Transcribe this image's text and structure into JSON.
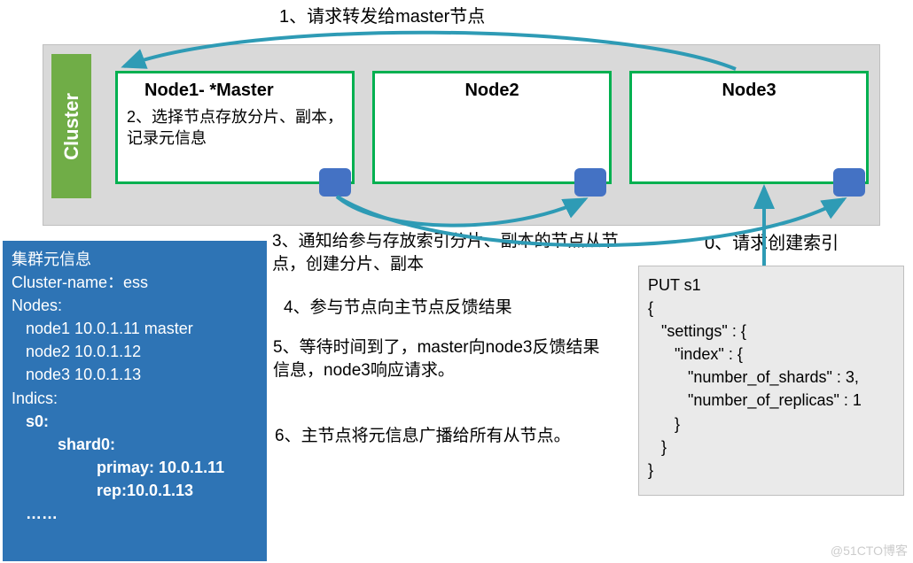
{
  "top_label": "1、请求转发给master节点",
  "cluster_label": "Cluster",
  "nodes": {
    "node1": {
      "title": "Node1- *Master",
      "body": "2、选择节点存放分片、副本，记录元信息"
    },
    "node2": {
      "title": "Node2",
      "body": ""
    },
    "node3": {
      "title": "Node3",
      "body": ""
    }
  },
  "steps": {
    "s0": "0、请求创建索引",
    "s3": "3、通知给参与存放索引分片、副本的节点从节点，创建分片、副本",
    "s4": "4、参与节点向主节点反馈结果",
    "s5": "5、等待时间到了，master向node3反馈结果信息，node3响应请求。",
    "s6": "6、主节点将元信息广播给所有从节点。"
  },
  "info": {
    "title": "集群元信息",
    "cluster_name_label": "Cluster-name：",
    "cluster_name_value": "ess",
    "nodes_label": "Nodes:",
    "node_lines": [
      "node1   10.0.1.11   master",
      "node2   10.0.1.12",
      "node3   10.0.1.13"
    ],
    "indics_label": "Indics:",
    "s0_label": "s0:",
    "shard_label": "shard0:",
    "primary": "primay: 10.0.1.11",
    "rep": "rep:10.0.1.13",
    "more": "……"
  },
  "code": {
    "line1": "PUT s1",
    "line2": "{",
    "line3": "   \"settings\" : {",
    "line4": "      \"index\" : {",
    "line5": "         \"number_of_shards\" : 3,",
    "line6": "         \"number_of_replicas\" : 1",
    "line7": "      }",
    "line8": "   }",
    "line9": "}"
  },
  "watermark": "@51CTO博客"
}
